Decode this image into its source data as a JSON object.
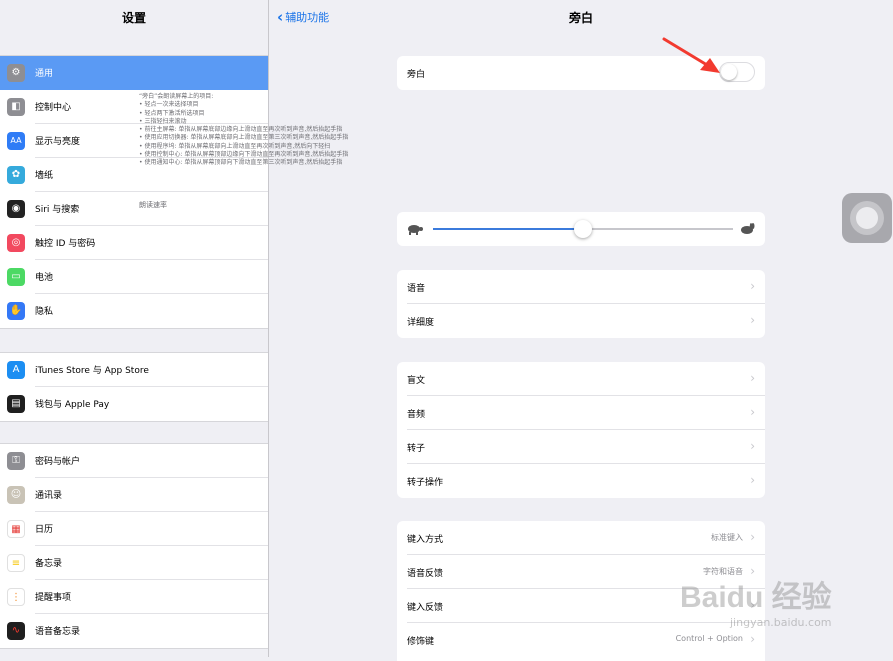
{
  "sidebar": {
    "title": "设置",
    "groups": [
      [
        {
          "label": "通用",
          "icon": "gear-icon",
          "selected": true
        },
        {
          "label": "控制中心",
          "icon": "switches-icon"
        },
        {
          "label": "显示与亮度",
          "icon": "brightness-icon"
        },
        {
          "label": "墙纸",
          "icon": "wallpaper-icon"
        },
        {
          "label": "Siri 与搜索",
          "icon": "siri-icon"
        },
        {
          "label": "触控 ID 与密码",
          "icon": "fingerprint-icon"
        },
        {
          "label": "电池",
          "icon": "battery-icon"
        },
        {
          "label": "隐私",
          "icon": "hand-icon"
        }
      ],
      [
        {
          "label": "iTunes Store 与 App Store",
          "icon": "app-store-icon"
        },
        {
          "label": "钱包与 Apple Pay",
          "icon": "wallet-icon"
        }
      ],
      [
        {
          "label": "密码与帐户",
          "icon": "key-icon"
        },
        {
          "label": "通讯录",
          "icon": "contacts-icon"
        },
        {
          "label": "日历",
          "icon": "calendar-icon"
        },
        {
          "label": "备忘录",
          "icon": "notes-icon"
        },
        {
          "label": "提醒事项",
          "icon": "reminders-icon"
        },
        {
          "label": "语音备忘录",
          "icon": "voice-memos-icon"
        }
      ]
    ]
  },
  "nav": {
    "back_label": "辅助功能",
    "title": "旁白"
  },
  "voiceover": {
    "label": "旁白",
    "enabled": false,
    "description": [
      "“旁白”会朗读屏幕上的项目:",
      "• 轻点一次来选择项目",
      "• 轻点两下激活所选项目",
      "• 三指轻扫来滚动",
      "• 前往主屏幕: 单指从屏幕底部边缘向上滑动直至再次听到声音,然后抬起手指",
      "• 使用应用切换器: 单指从屏幕底部向上滑动直至第三次听到声音,然后抬起手指",
      "• 使用程序坞: 单指从屏幕底部向上滑动直至再次听到声音,然后向下轻扫",
      "• 使用控制中心: 单指从屏幕顶部边缘向下滑动直至再次听到声音,然后抬起手指",
      "• 使用通知中心: 单指从屏幕顶部向下滑动直至第三次听到声音,然后抬起手指"
    ]
  },
  "speaking_rate": {
    "label": "朗读速率",
    "value": 0.5
  },
  "groups": [
    [
      {
        "label": "语音"
      },
      {
        "label": "详细度"
      }
    ],
    [
      {
        "label": "盲文"
      },
      {
        "label": "音频"
      },
      {
        "label": "转子"
      },
      {
        "label": "转子操作"
      }
    ],
    [
      {
        "label": "键入方式",
        "value": "标准键入"
      },
      {
        "label": "语音反馈",
        "value": "字符和语音"
      },
      {
        "label": "键入反馈"
      },
      {
        "label": "修饰键",
        "value": "Control + Option"
      }
    ]
  ],
  "watermark": {
    "logo": "Baidu 经验",
    "url": "jingyan.baidu.com"
  },
  "colors": {
    "accent": "#1a73e8",
    "selection": "#5a9af4"
  }
}
